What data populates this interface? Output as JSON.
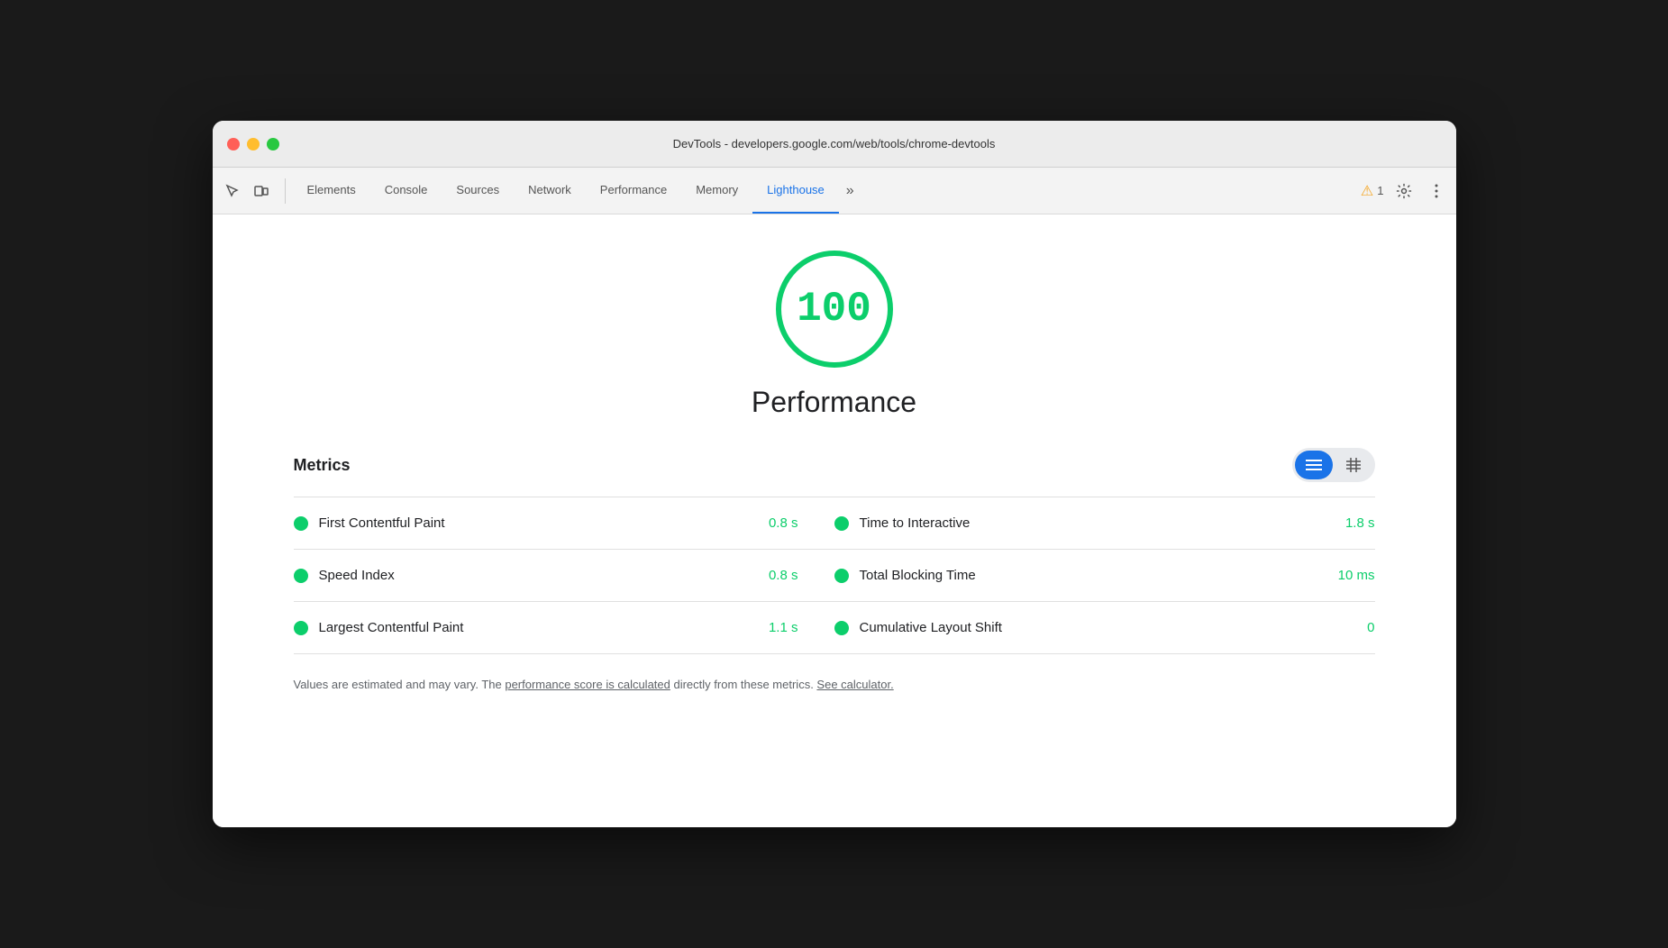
{
  "window": {
    "title": "DevTools - developers.google.com/web/tools/chrome-devtools"
  },
  "tabs": [
    {
      "id": "elements",
      "label": "Elements",
      "active": false
    },
    {
      "id": "console",
      "label": "Console",
      "active": false
    },
    {
      "id": "sources",
      "label": "Sources",
      "active": false
    },
    {
      "id": "network",
      "label": "Network",
      "active": false
    },
    {
      "id": "performance",
      "label": "Performance",
      "active": false
    },
    {
      "id": "memory",
      "label": "Memory",
      "active": false
    },
    {
      "id": "lighthouse",
      "label": "Lighthouse",
      "active": true
    }
  ],
  "more_tabs": "»",
  "warning": {
    "count": "1"
  },
  "score": {
    "value": "100",
    "label": "Performance"
  },
  "metrics": {
    "title": "Metrics",
    "view_toggle": {
      "list_icon": "≡",
      "grid_icon": "⊞"
    },
    "items": [
      {
        "id": "fcp",
        "name": "First Contentful Paint",
        "value": "0.8 s",
        "color": "#0cce6b"
      },
      {
        "id": "tti",
        "name": "Time to Interactive",
        "value": "1.8 s",
        "color": "#0cce6b"
      },
      {
        "id": "si",
        "name": "Speed Index",
        "value": "0.8 s",
        "color": "#0cce6b"
      },
      {
        "id": "tbt",
        "name": "Total Blocking Time",
        "value": "10 ms",
        "color": "#0cce6b"
      },
      {
        "id": "lcp",
        "name": "Largest Contentful Paint",
        "value": "1.1 s",
        "color": "#0cce6b"
      },
      {
        "id": "cls",
        "name": "Cumulative Layout Shift",
        "value": "0",
        "color": "#0cce6b"
      }
    ]
  },
  "footer": {
    "text_before": "Values are estimated and may vary. The ",
    "link1": "performance score is calculated",
    "text_middle": " directly from these metrics. ",
    "link2": "See calculator."
  }
}
